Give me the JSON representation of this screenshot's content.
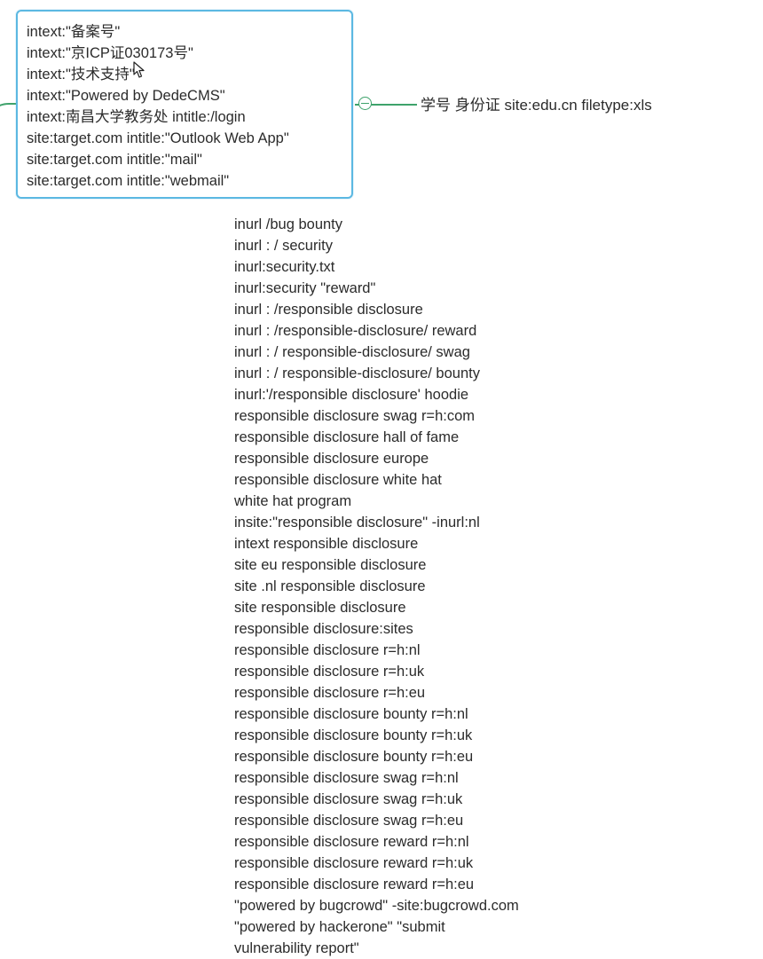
{
  "mindmap": {
    "node_lines": [
      "intext:\"备案号\"",
      "intext:\"京ICP证030173号\"",
      "intext:\"技术支持\"",
      "intext:\"Powered by DedeCMS\"",
      "intext:南昌大学教务处 intitle:/login",
      "site:target.com intitle:\"Outlook Web App\"",
      "site:target.com intitle:\"mail\"",
      "site:target.com intitle:\"webmail\""
    ],
    "branch_label": "学号 身份证 site:edu.cn filetype:xls",
    "list_lines": [
      "inurl /bug bounty",
      "inurl : / security",
      "inurl:security.txt",
      "inurl:security \"reward\"",
      "inurl : /responsible disclosure",
      "inurl : /responsible-disclosure/ reward",
      "inurl : / responsible-disclosure/ swag",
      "inurl : / responsible-disclosure/ bounty",
      "inurl:'/responsible disclosure' hoodie",
      "responsible disclosure swag r=h:com",
      "responsible disclosure hall of fame",
      "responsible disclosure europe",
      "responsible disclosure white hat",
      "white hat program",
      "insite:\"responsible disclosure\" -inurl:nl",
      "intext responsible disclosure",
      "site eu responsible disclosure",
      "site .nl responsible disclosure",
      "site responsible disclosure",
      "responsible disclosure:sites",
      "responsible disclosure r=h:nl",
      "responsible disclosure r=h:uk",
      "responsible disclosure r=h:eu",
      "responsible disclosure bounty r=h:nl",
      "responsible disclosure bounty r=h:uk",
      "responsible disclosure bounty r=h:eu",
      "responsible disclosure swag r=h:nl",
      "responsible disclosure swag r=h:uk",
      "responsible disclosure swag r=h:eu",
      "responsible disclosure reward r=h:nl",
      "responsible disclosure reward r=h:uk",
      "responsible disclosure reward r=h:eu",
      "\"powered by bugcrowd\" -site:bugcrowd.com",
      "\"powered by hackerone\" \"submit",
      "vulnerability report\""
    ],
    "colors": {
      "node_border": "#5bb8e2",
      "connector": "#3ea26b",
      "text": "#2b2b2b"
    },
    "icons": {
      "collapse": "collapse-minus-icon",
      "cursor": "mouse-cursor-icon"
    }
  }
}
